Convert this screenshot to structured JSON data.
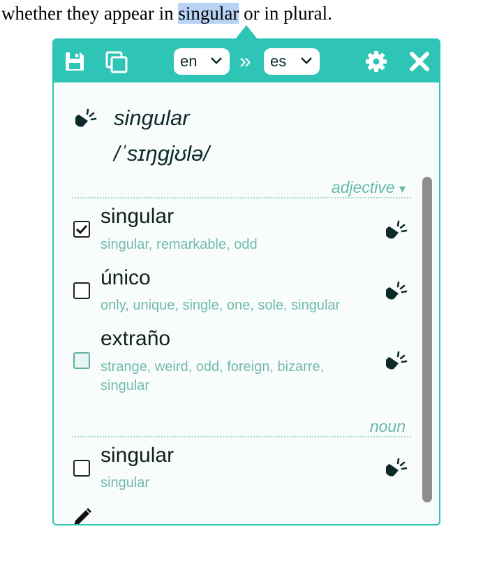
{
  "page": {
    "text_before": "whether they appear in ",
    "highlight": "singular",
    "text_after": " or in plural."
  },
  "toolbar": {
    "source_lang": "en",
    "separator": "»",
    "target_lang": "es"
  },
  "headword": {
    "word": "singular",
    "phonetic": "/ˈsɪŋgjʊlə/"
  },
  "groups": [
    {
      "pos": "adjective",
      "pos_suffix": "▾",
      "entries": [
        {
          "word": "singular",
          "synonyms": "singular, remarkable, odd",
          "checked": true
        },
        {
          "word": "único",
          "synonyms": "only, unique, single, one, sole, singular",
          "checked": false
        },
        {
          "word": "extraño",
          "synonyms": "strange, weird, odd, foreign, bizarre, singular",
          "checked": false
        }
      ]
    },
    {
      "pos": "noun",
      "entries": [
        {
          "word": "singular",
          "synonyms": "singular",
          "checked": false
        }
      ]
    }
  ],
  "colors": {
    "accent": "#2ec4b6",
    "synonym_text": "#72b9af",
    "highlight": "#b9d3f5"
  }
}
